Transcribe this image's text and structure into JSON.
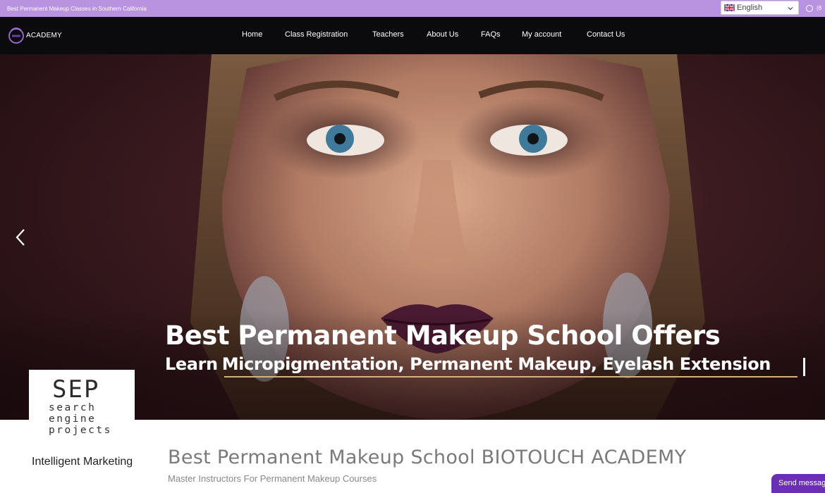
{
  "topbar": {
    "announcement": "Best Permanent Makeup Classes in Southern California",
    "language": "English",
    "phone_partial": "(8"
  },
  "brand": {
    "name": "ACADEMY"
  },
  "nav": {
    "items": [
      {
        "label": "Home"
      },
      {
        "label": "Class Registration"
      },
      {
        "label": "Teachers"
      },
      {
        "label": "About Us"
      },
      {
        "label": "FAQs"
      },
      {
        "label": "My account"
      },
      {
        "label": "Contact Us"
      }
    ]
  },
  "hero": {
    "title": "Best Permanent Makeup School Offers",
    "subtitle_prefix": "Learn",
    "subtitle_typed": "Micropigmentation, Permanent Makeup, Eyelash Extension"
  },
  "sep_badge": {
    "logo": "SEP",
    "words": [
      "search",
      "engine",
      "projects"
    ],
    "tagline": "Intelligent Marketing"
  },
  "content": {
    "title": "Best Permanent Makeup School BIOTOUCH ACADEMY",
    "subtitle": "Master Instructors For Permanent Makeup Courses"
  },
  "chat": {
    "label": "Send message"
  },
  "colors": {
    "topbar": "#b992e0",
    "navbar": "#0b0b0d",
    "accent_underline": "#d8b17a",
    "chat": "#6b2fb3"
  }
}
